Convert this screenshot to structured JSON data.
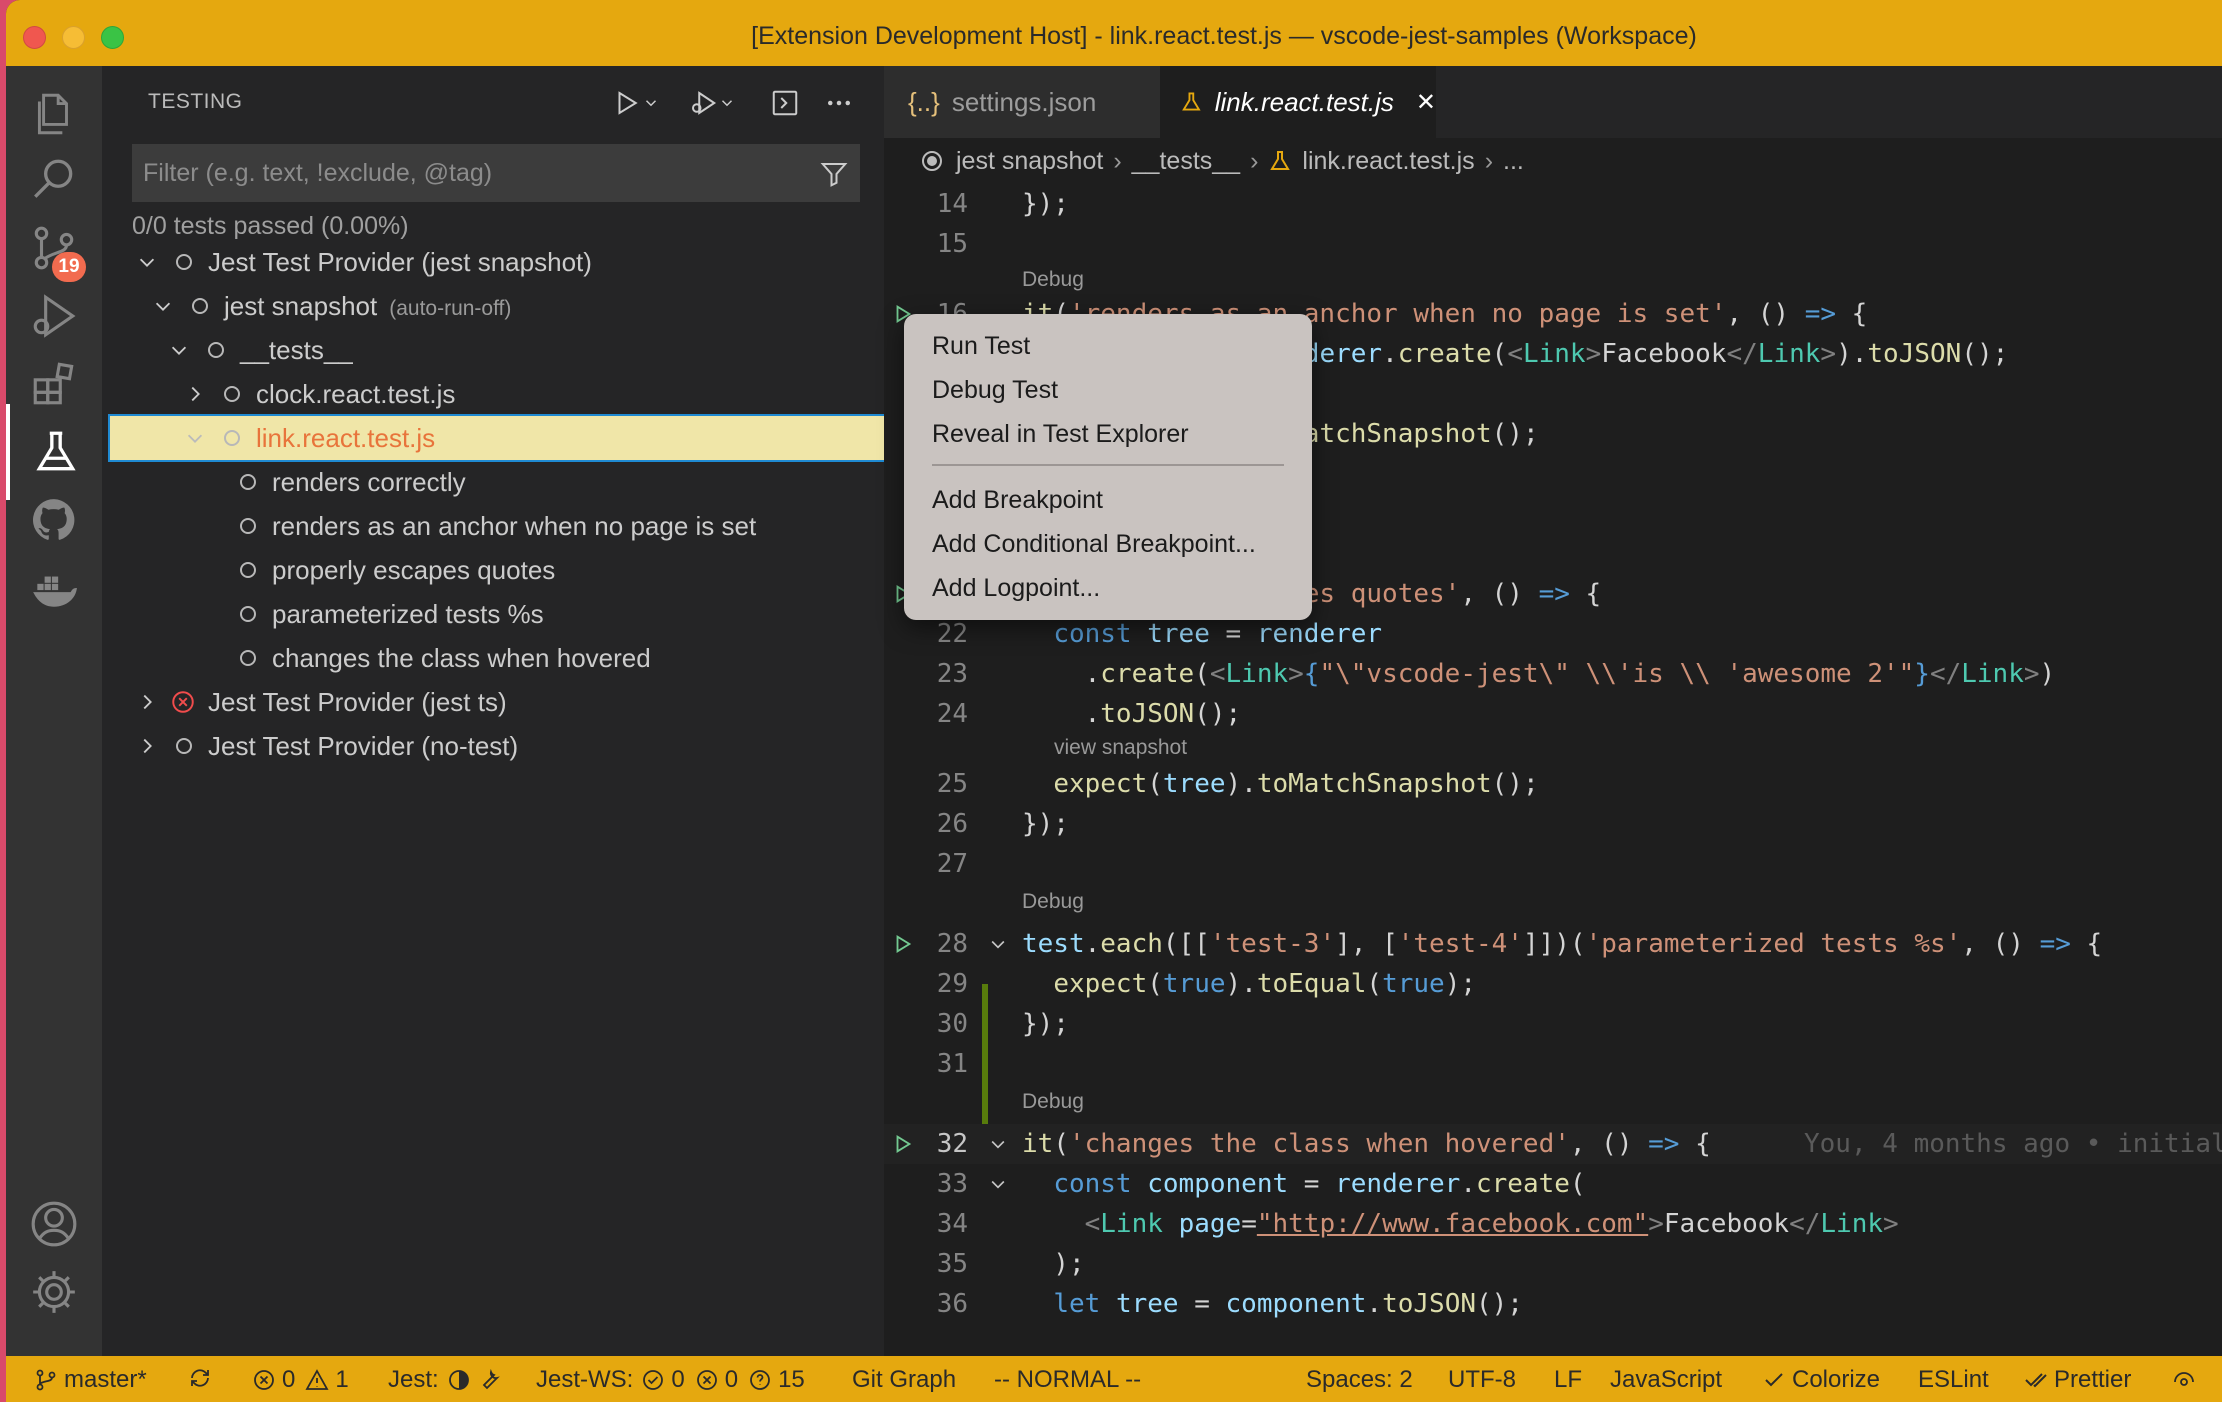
{
  "window": {
    "title": "[Extension Development Host] - link.react.test.js — vscode-jest-samples (Workspace)"
  },
  "activity_bar": {
    "source_control_badge": "19"
  },
  "sidebar": {
    "title": "TESTING",
    "filter_placeholder": "Filter (e.g. text, !exclude, @tag)",
    "status": "0/0 tests passed (0.00%)",
    "tree": [
      {
        "label": "Jest Test Provider (jest snapshot)",
        "sublabel": ""
      },
      {
        "label": "jest snapshot",
        "sublabel": "(auto-run-off)"
      },
      {
        "label": "__tests__",
        "sublabel": ""
      },
      {
        "label": "clock.react.test.js",
        "sublabel": ""
      },
      {
        "label": "link.react.test.js",
        "sublabel": ""
      },
      {
        "label": "renders correctly",
        "sublabel": ""
      },
      {
        "label": "renders as an anchor when no page is set",
        "sublabel": ""
      },
      {
        "label": "properly escapes quotes",
        "sublabel": ""
      },
      {
        "label": "parameterized tests %s",
        "sublabel": ""
      },
      {
        "label": "changes the class when hovered",
        "sublabel": ""
      },
      {
        "label": "Jest Test Provider (jest ts)",
        "sublabel": ""
      },
      {
        "label": "Jest Test Provider (no-test)",
        "sublabel": ""
      }
    ]
  },
  "editor": {
    "tabs": [
      {
        "icon": "{..}",
        "label": "settings.json"
      },
      {
        "icon": "flask",
        "label": "link.react.test.js",
        "close": "✕"
      }
    ],
    "breadcrumb": [
      "jest snapshot",
      "__tests__",
      "link.react.test.js",
      "..."
    ],
    "codelens": {
      "debug": "Debug",
      "view_snapshot": "view snapshot"
    },
    "line_numbers": [
      "14",
      "15",
      "16",
      "22",
      "23",
      "24",
      "25",
      "26",
      "27",
      "28",
      "29",
      "30",
      "31",
      "32",
      "33",
      "34",
      "35",
      "36"
    ],
    "blame": "You, 4 months ago • initial"
  },
  "context_menu": {
    "items": [
      "Run Test",
      "Debug Test",
      "Reveal in Test Explorer",
      "Add Breakpoint",
      "Add Conditional Breakpoint...",
      "Add Logpoint..."
    ]
  },
  "status_bar": {
    "branch": "master*",
    "errors": "0",
    "warnings": "1",
    "jest": "Jest:",
    "jest_ws": "Jest-WS:",
    "jest_ws_pass": "0",
    "jest_ws_fail": "0",
    "jest_ws_unknown": "15",
    "git_graph": "Git Graph",
    "mode": "-- NORMAL --",
    "spaces": "Spaces: 2",
    "encoding": "UTF-8",
    "eol": "LF",
    "language": "JavaScript",
    "colorize": "Colorize",
    "eslint": "ESLint",
    "prettier": "Prettier"
  },
  "colors": {
    "titlebar": "#e5a80f",
    "statusbar": "#e5a80f",
    "selection": "#f0e6a8",
    "accent": "#1f8ad2"
  }
}
